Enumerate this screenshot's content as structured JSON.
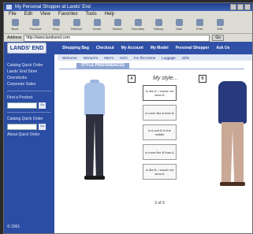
{
  "window": {
    "title": "My Personal Shopper at Lands' End"
  },
  "menubar": [
    "File",
    "Edit",
    "View",
    "Favorites",
    "Tools",
    "Help"
  ],
  "toolbar": [
    "Back",
    "Forward",
    "Stop",
    "Refresh",
    "Home",
    "Search",
    "Favorites",
    "History",
    "Mail",
    "Print",
    "Edit"
  ],
  "address": {
    "label": "Address",
    "url": "http://www.landsend.com",
    "go": "Go"
  },
  "header": {
    "logo": "LANDS' END",
    "nav": [
      "Shopping Bag",
      "Checkout",
      "My Account",
      "My Model",
      "Personal Shopper",
      "Ask Us"
    ]
  },
  "subnav": [
    "Welcome",
    "Women's",
    "Men's",
    "Kid's",
    "For the Home",
    "Luggage",
    "Gifts"
  ],
  "sidebar": {
    "links": [
      "Catalog Quick Order",
      "Lands' End Store",
      "Overstocks",
      "Corporate Sales"
    ],
    "find_label": "Find a Product",
    "go": "Go",
    "catalog_label": "Catalog Quick Order",
    "catalog_link": "About Quick Order",
    "footer": "© 2001"
  },
  "main": {
    "section_title": "STYLE PREFERENCES",
    "badge_a": "A",
    "badge_b": "B",
    "my_style": "My style...",
    "choices": [
      "is like A, I would not wear B",
      "is more like A than B",
      "is A and B in the middle",
      "is more like B than A",
      "is like B, I would not wear A"
    ],
    "page_count": "2 of 5"
  }
}
